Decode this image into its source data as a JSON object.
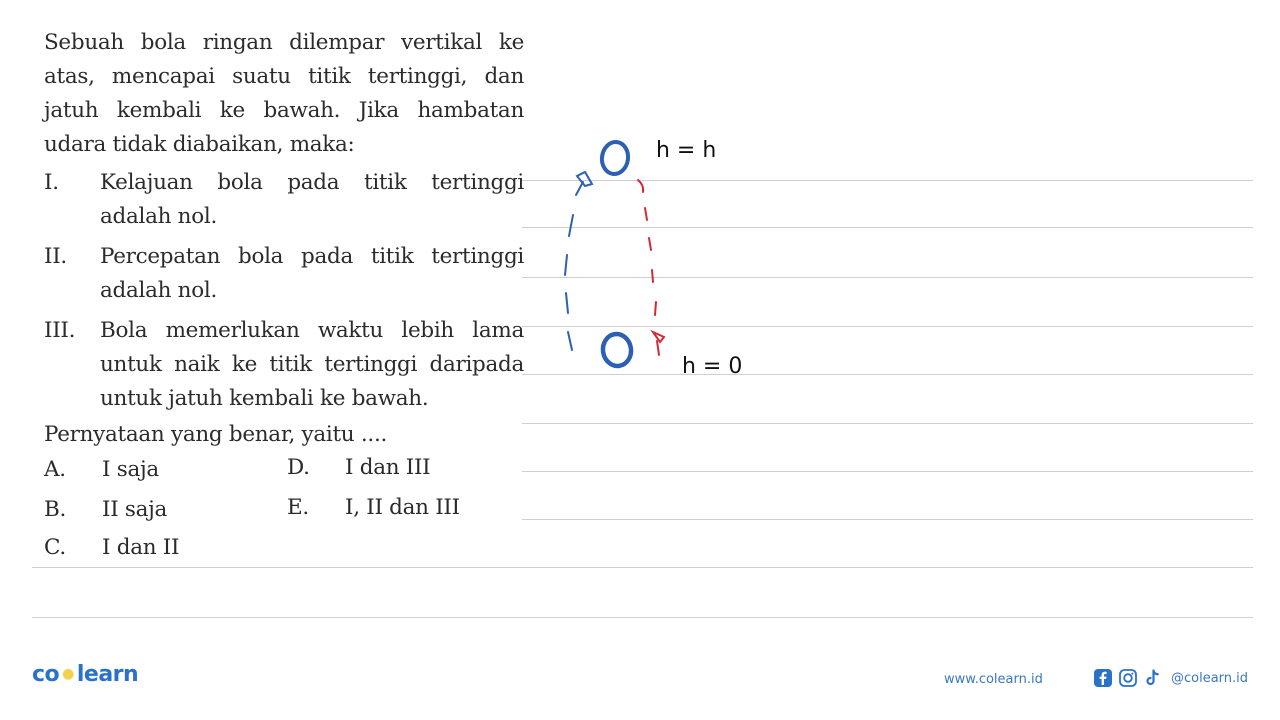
{
  "question": {
    "stem_lines": [
      "Sebuah bola ringan dilempar vertikal ke",
      "atas, mencapai suatu titik tertinggi, dan",
      "jatuh kembali ke bawah. Jika hambatan",
      "udara tidak diabaikan, maka:"
    ],
    "statements": [
      {
        "num": "I.",
        "text": "Kelajuan bola pada titik tertinggi adalah nol."
      },
      {
        "num": "II.",
        "text": "Percepatan bola pada titik tertinggi adalah nol."
      },
      {
        "num": "III.",
        "text": "Bola memerlukan waktu lebih lama untuk naik ke titik tertinggi daripada untuk jatuh kembali ke bawah."
      }
    ],
    "prompt": "Pernyataan yang benar, yaitu ....",
    "options": [
      {
        "label": "A.",
        "text": "I saja"
      },
      {
        "label": "B.",
        "text": "II saja"
      },
      {
        "label": "C.",
        "text": "I dan II"
      },
      {
        "label": "D.",
        "text": "I dan III"
      },
      {
        "label": "E.",
        "text": "I, II dan III"
      }
    ]
  },
  "sketch": {
    "top_label": "h = h",
    "bottom_label": "h = 0",
    "colors": {
      "ball": "#2d5fb3",
      "upward_path": "#2d5fb3",
      "downward_path": "#d42a35",
      "ink": "#111111"
    }
  },
  "footer": {
    "logo_left": "co",
    "logo_right": "learn",
    "website": "www.colearn.id",
    "social_handle": "@colearn.id",
    "social_icons": [
      "facebook-icon",
      "instagram-icon",
      "tiktok-icon"
    ],
    "brand_color": "#2a72c8",
    "logo_dot_color": "#f2d24a"
  }
}
